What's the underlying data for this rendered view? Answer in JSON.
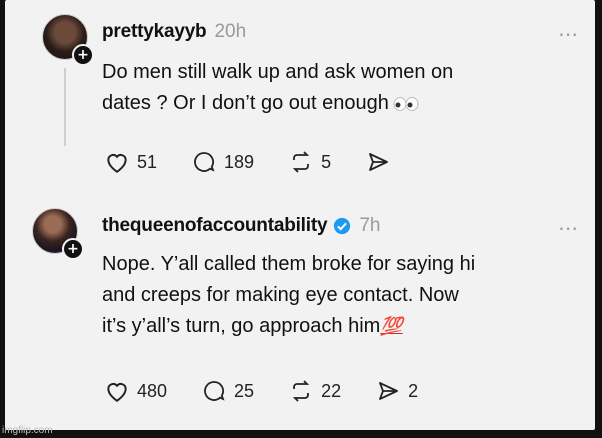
{
  "posts": [
    {
      "username": "prettykayyb",
      "time": "20h",
      "text_lines": [
        "Do men still walk up and ask women on",
        "dates ? Or I don’t go out enough"
      ],
      "likes": "51",
      "replies": "189",
      "reposts": "5",
      "shares": ""
    },
    {
      "username": "thequeenofaccountability",
      "time": "7h",
      "verified": true,
      "text_lines": [
        "Nope. Y’all called them broke for saying hi",
        "and creeps for making eye contact. Now",
        "it’s y’all’s turn, go approach him"
      ],
      "emoji": "💯",
      "likes": "480",
      "replies": "25",
      "reposts": "22",
      "shares": "2"
    }
  ],
  "more_icon": "⋯",
  "watermark": "imgflip.com",
  "colors": {
    "verified": "#1d9bf0",
    "time": "#9a9a9a",
    "emoji_100": "#d8262d"
  }
}
